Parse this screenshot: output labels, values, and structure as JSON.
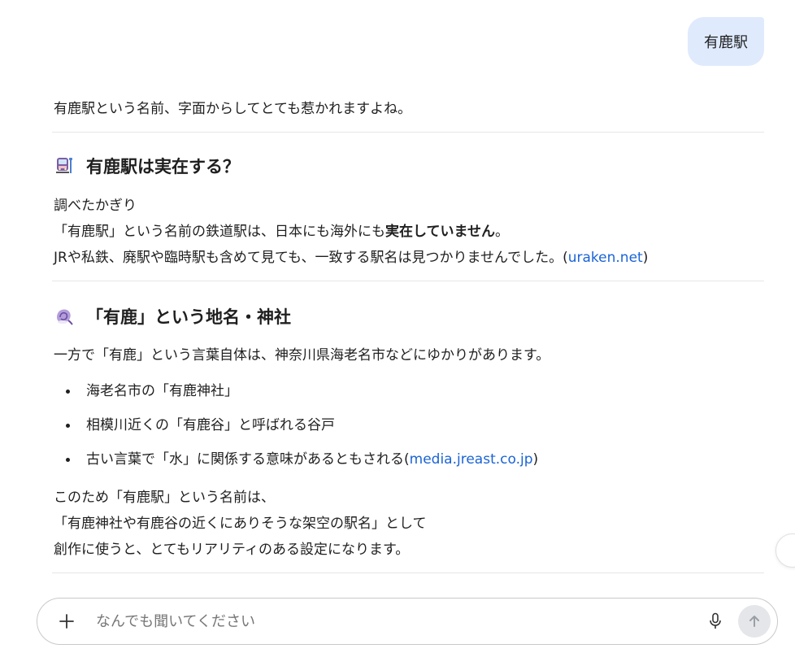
{
  "user_message": "有鹿駅",
  "answer": {
    "intro": "有鹿駅という名前、字面からしてとても惹かれますよね。",
    "section1": {
      "emoji_icon": "train-icon",
      "title": "有鹿駅は実在する？",
      "line1": "調べたかぎり",
      "line2_pre": "「有鹿駅」という名前の鉄道駅は、日本にも海外にも",
      "line2_bold": "実在していません",
      "line2_post": "。",
      "line3_pre": "JRや私鉄、廃駅や臨時駅も含めて見ても、一致する駅名は見つかりませんでした。(",
      "line3_link": "uraken.net",
      "line3_post": ")"
    },
    "section2": {
      "emoji_icon": "shell-icon",
      "title": "「有鹿」という地名・神社",
      "lead": "一方で「有鹿」という言葉自体は、神奈川県海老名市などにゆかりがあります。",
      "bullets": [
        "海老名市の「有鹿神社」",
        "相模川近くの「有鹿谷」と呼ばれる谷戸"
      ],
      "bullet3_pre": "古い言葉で「水」に関係する意味があるともされる(",
      "bullet3_link": "media.jreast.co.jp",
      "bullet3_post": ")",
      "closing1": "このため「有鹿駅」という名前は、",
      "closing2": "「有鹿神社や有鹿谷の近くにありそうな架空の駅名」として",
      "closing3": "創作に使うと、とてもリアリティのある設定になります。"
    }
  },
  "composer": {
    "placeholder": "なんでも聞いてください",
    "value": ""
  },
  "colors": {
    "user_bubble": "#dfeafd",
    "link": "#1a63d6",
    "send_button": "#e4e6ea"
  }
}
